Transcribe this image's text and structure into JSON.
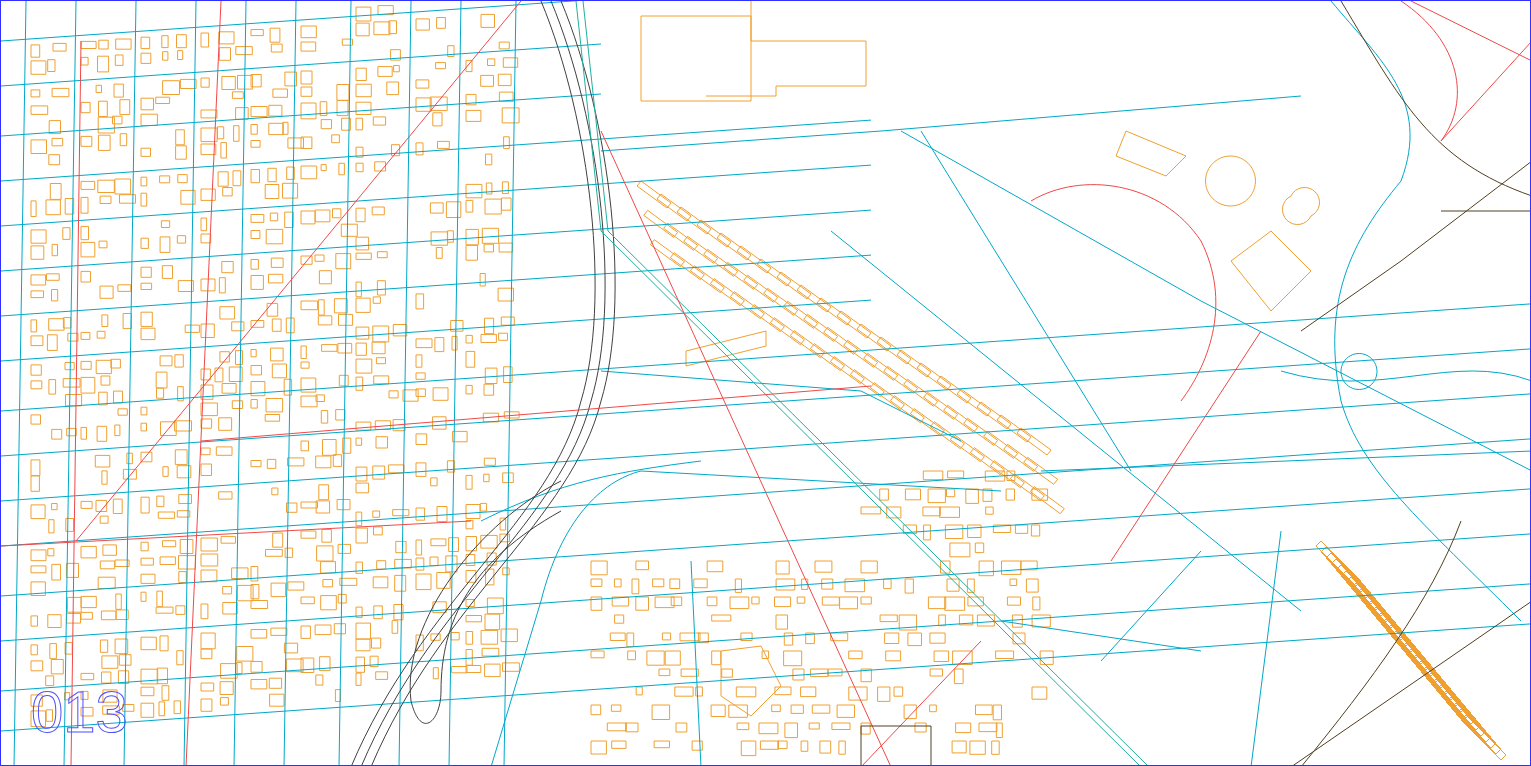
{
  "sheet_label": "013"
}
